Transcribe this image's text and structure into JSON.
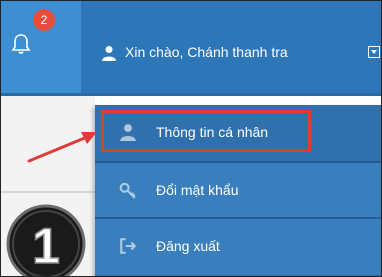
{
  "notifications": {
    "count": "2",
    "icon": "bell-icon"
  },
  "user_menu": {
    "greeting": "Xin chào, Chánh thanh tra",
    "icon": "user-icon",
    "caret_icon": "caret-down-icon"
  },
  "dropdown": {
    "items": [
      {
        "label": "Thông tin cá nhân",
        "icon": "user-icon"
      },
      {
        "label": "Đổi mật khẩu",
        "icon": "key-icon"
      },
      {
        "label": "Đăng xuất",
        "icon": "sign-out-icon"
      }
    ]
  },
  "annotation": {
    "step_number": "1",
    "highlight_color": "#e03b3b"
  },
  "colors": {
    "topbar": "#3d8fd1",
    "user_menu": "#2d76b7",
    "dropdown": "#2f70ad",
    "badge": "#e74c3c"
  }
}
